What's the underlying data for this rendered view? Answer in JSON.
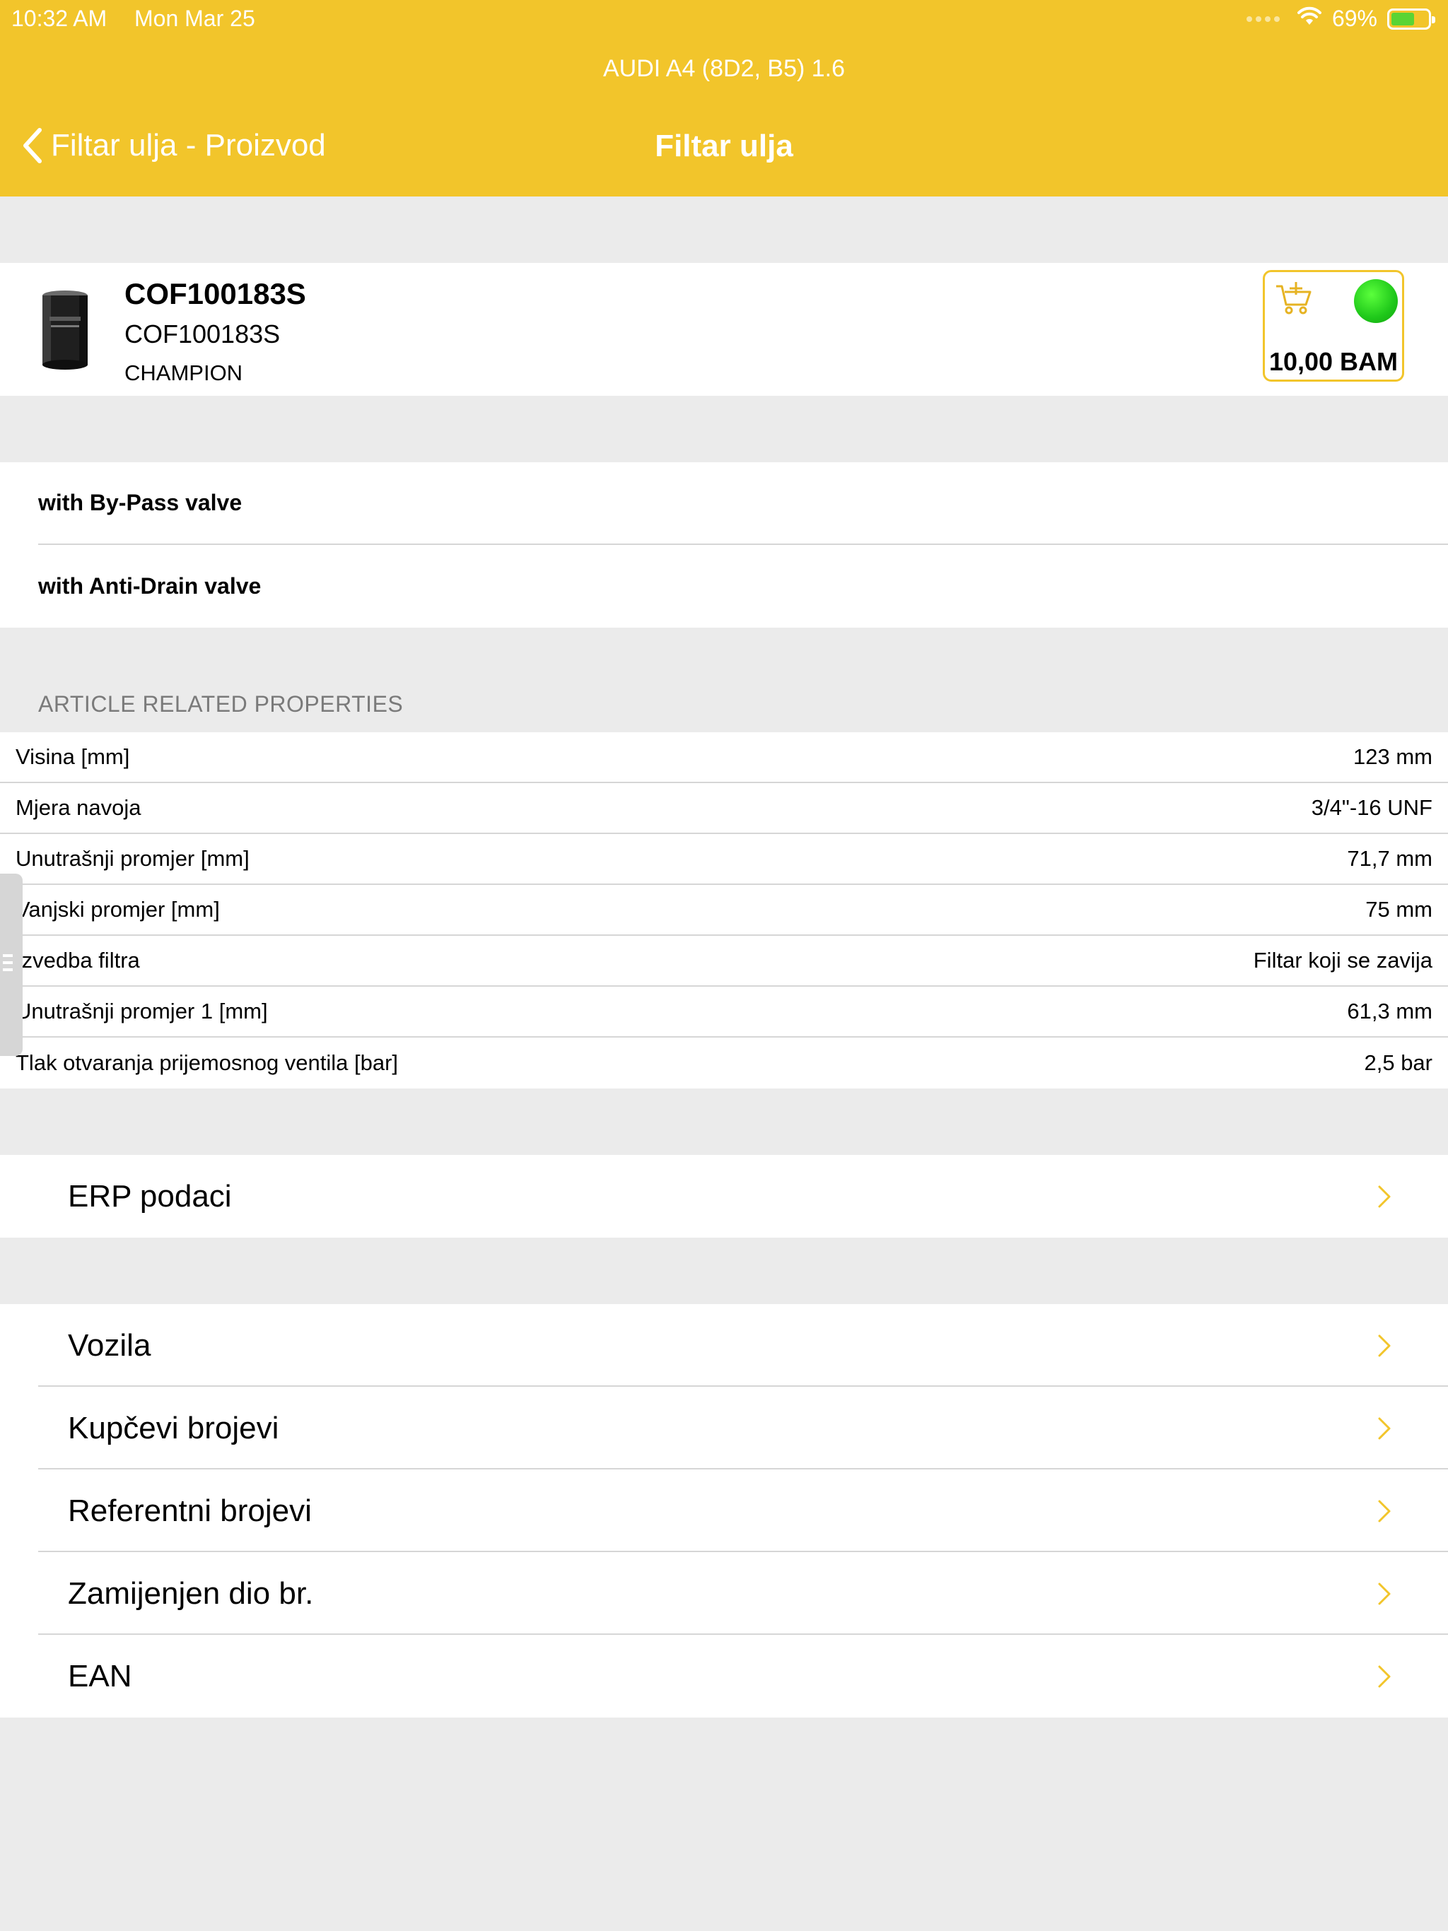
{
  "status_bar": {
    "time": "10:32 AM",
    "date": "Mon Mar 25",
    "battery_percent": "69%",
    "battery_level": 0.69,
    "wifi": "wifi-icon"
  },
  "header": {
    "vehicle": "AUDI A4 (8D2, B5) 1.6",
    "back_label": "Filtar ulja - Proizvod",
    "title": "Filtar ulja",
    "color": "#f2c52b"
  },
  "product": {
    "name": "COF100183S",
    "code": "COF100183S",
    "brand": "CHAMPION",
    "price": "10,00 BAM",
    "stock_status_color": "#1fc81a"
  },
  "features": [
    {
      "label": "with By-Pass valve"
    },
    {
      "label": "with Anti-Drain valve"
    }
  ],
  "properties": {
    "section_title": "ARTICLE RELATED PROPERTIES",
    "rows": [
      {
        "name": "Visina [mm]",
        "value": "123 mm"
      },
      {
        "name": "Mjera navoja",
        "value": "3/4\"-16 UNF"
      },
      {
        "name": "Unutrašnji promjer [mm]",
        "value": "71,7 mm"
      },
      {
        "name": "Vanjski promjer [mm]",
        "value": "75 mm"
      },
      {
        "name": "Izvedba filtra",
        "value": "Filtar koji se zavija"
      },
      {
        "name": "Unutrašnji promjer 1 [mm]",
        "value": "61,3 mm"
      },
      {
        "name": "Tlak otvaranja prijemosnog ventila [bar]",
        "value": "2,5 bar"
      }
    ]
  },
  "menu_group_1": [
    {
      "label": "ERP podaci"
    }
  ],
  "menu_group_2": [
    {
      "label": "Vozila"
    },
    {
      "label": "Kupčevi brojevi"
    },
    {
      "label": "Referentni brojevi"
    },
    {
      "label": "Zamijenjen dio br."
    },
    {
      "label": "EAN"
    }
  ]
}
